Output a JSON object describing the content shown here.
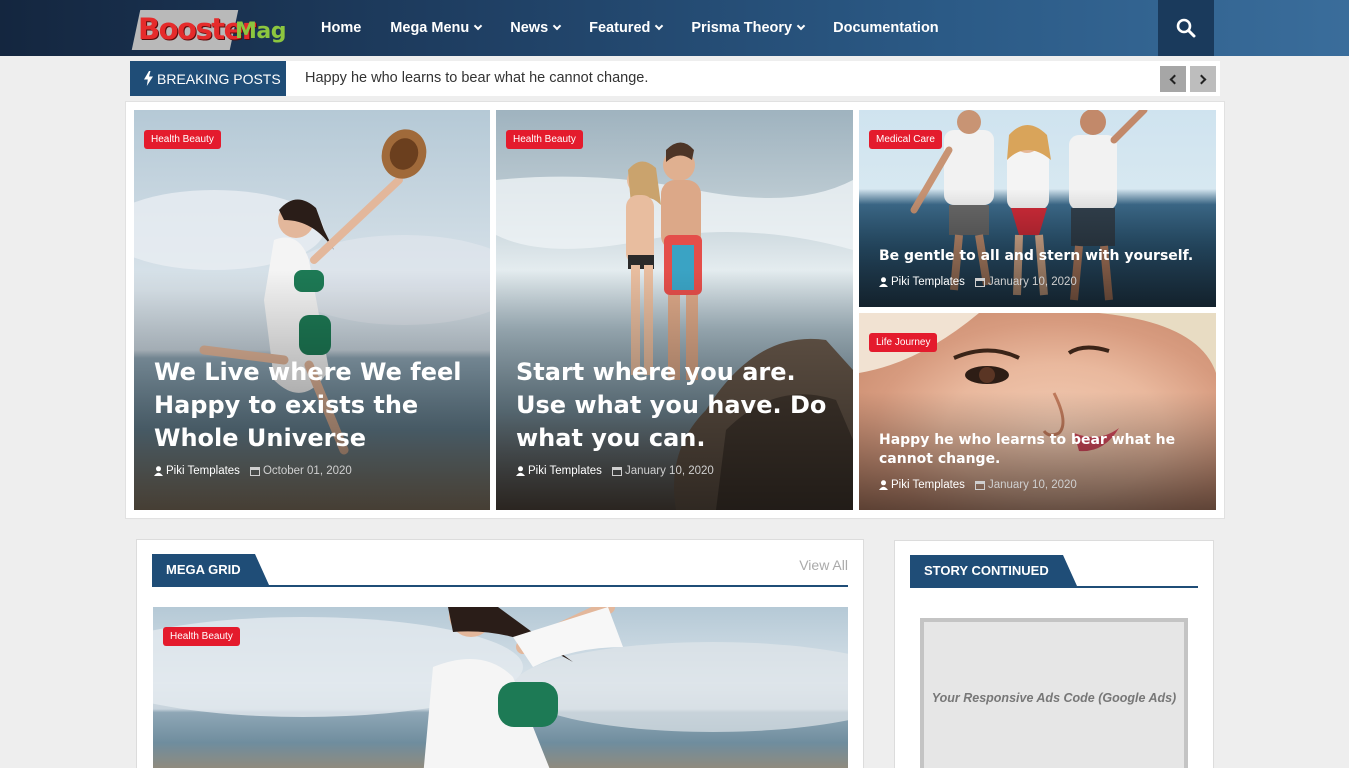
{
  "header": {
    "logo_part1": "Booster",
    "logo_part2": "Mag",
    "nav": [
      {
        "label": "Home",
        "dropdown": false
      },
      {
        "label": "Mega Menu",
        "dropdown": true
      },
      {
        "label": "News",
        "dropdown": true
      },
      {
        "label": "Featured",
        "dropdown": true
      },
      {
        "label": "Prisma Theory",
        "dropdown": true
      },
      {
        "label": "Documentation",
        "dropdown": false
      }
    ],
    "search_icon": "search-icon"
  },
  "breaking": {
    "label": "BREAKING POSTS",
    "text": "Happy he who learns to bear what he cannot change."
  },
  "featured": [
    {
      "tag": "Health Beauty",
      "title": "We Live where We feel Happy to exists the Whole Universe",
      "author": "Piki Templates",
      "date": "October 01, 2020"
    },
    {
      "tag": "Health Beauty",
      "title": "Start where you are. Use what you have. Do what you can.",
      "author": "Piki Templates",
      "date": "January 10, 2020"
    },
    {
      "tag": "Medical Care",
      "title": "Be gentle to all and stern with yourself.",
      "author": "Piki Templates",
      "date": "January 10, 2020"
    },
    {
      "tag": "Life Journey",
      "title": "Happy he who learns to bear what he cannot change.",
      "author": "Piki Templates",
      "date": "January 10, 2020"
    }
  ],
  "mega_grid": {
    "title": "MEGA GRID",
    "view_all": "View All",
    "first_tag": "Health Beauty"
  },
  "story": {
    "title": "STORY CONTINUED",
    "ad_text": "Your Responsive Ads Code (Google Ads)"
  },
  "colors": {
    "header_dark": "#14263f",
    "accent_blue": "#1f4d77",
    "tag_red": "#e41b2d",
    "logo_red": "#e52b2b",
    "logo_green": "#8cc63f"
  }
}
